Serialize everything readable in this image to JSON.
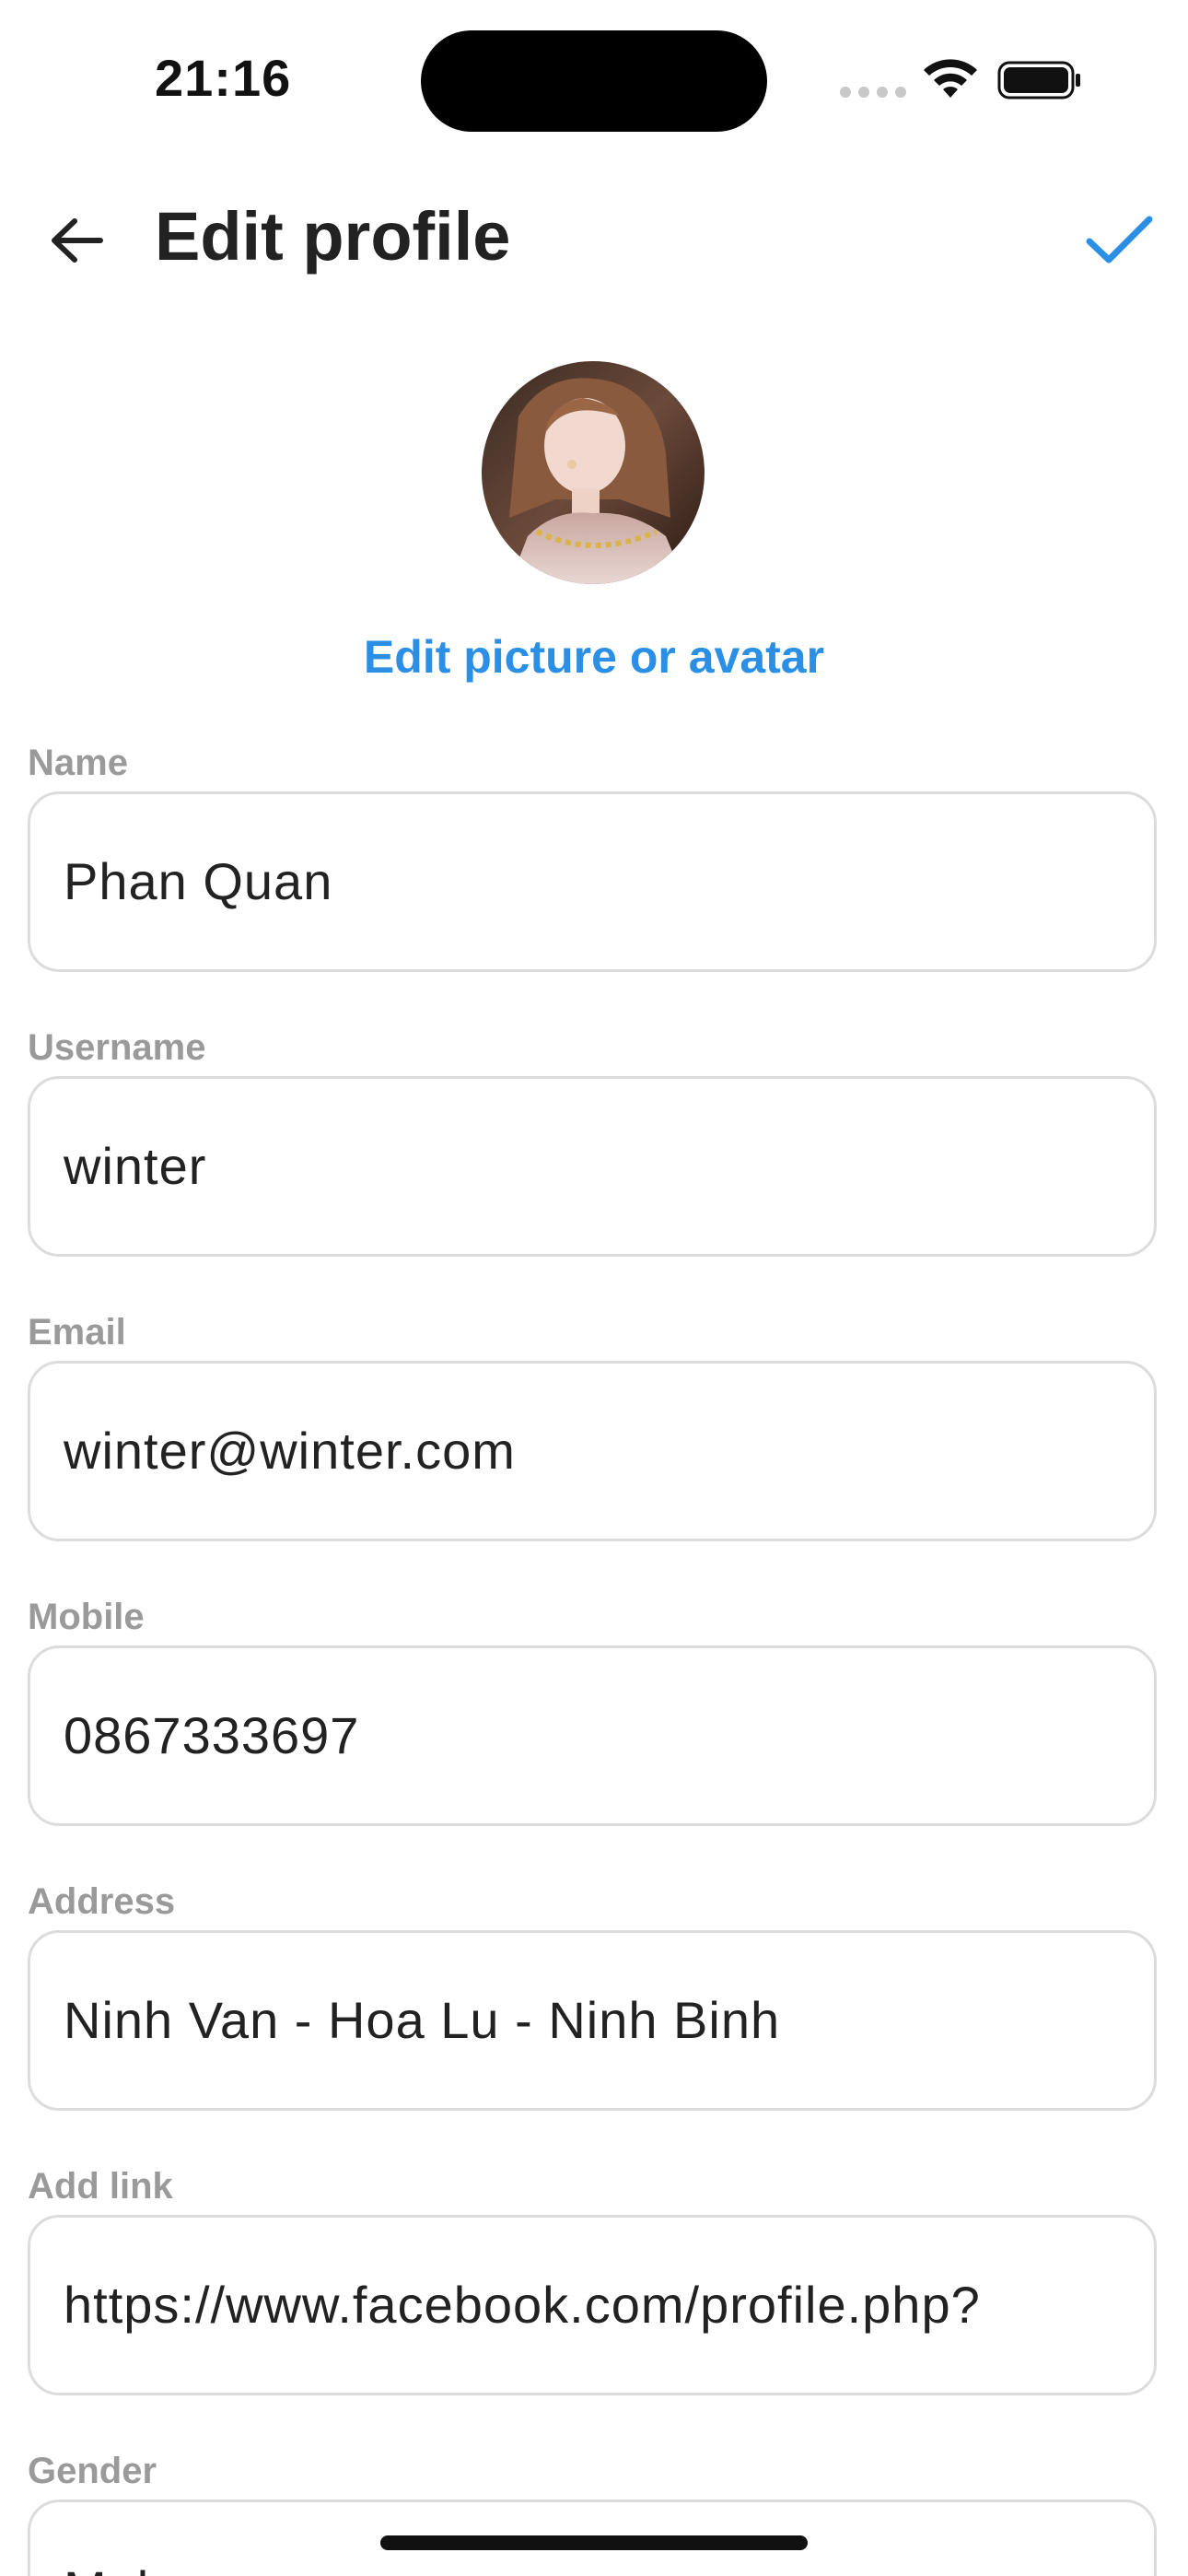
{
  "status_bar": {
    "time": "21:16",
    "icons": [
      "cellular-signal-icon",
      "wifi-icon",
      "battery-icon"
    ]
  },
  "header": {
    "back_icon": "arrow-left-icon",
    "title": "Edit profile",
    "confirm_icon": "checkmark-icon"
  },
  "avatar": {
    "edit_label": "Edit picture or avatar"
  },
  "colors": {
    "accent": "#2b8fe5",
    "label": "#9a9a9a",
    "border": "#dcdcdc",
    "text": "#222222"
  },
  "form": {
    "fields": [
      {
        "label": "Name",
        "value": "Phan Quan"
      },
      {
        "label": "Username",
        "value": "winter"
      },
      {
        "label": "Email",
        "value": "winter@winter.com"
      },
      {
        "label": "Mobile",
        "value": "0867333697"
      },
      {
        "label": "Address",
        "value": "Ninh Van - Hoa Lu - Ninh Binh"
      },
      {
        "label": "Add link",
        "value": "https://www.facebook.com/profile.php?"
      },
      {
        "label": "Gender",
        "value": "Male"
      }
    ]
  }
}
